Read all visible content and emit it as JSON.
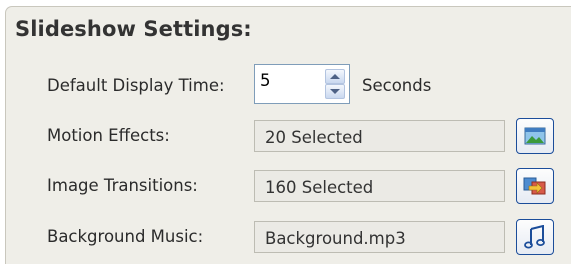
{
  "section_title": "Slideshow Settings:",
  "display_time": {
    "label": "Default Display Time:",
    "value": "5",
    "unit": "Seconds"
  },
  "motion_effects": {
    "label": "Motion Effects:",
    "value": "20 Selected",
    "button_icon": "image-icon"
  },
  "image_transitions": {
    "label": "Image Transitions:",
    "value": "160 Selected",
    "button_icon": "transition-icon"
  },
  "background_music": {
    "label": "Background Music:",
    "value": "Background.mp3",
    "button_icon": "music-note-icon"
  },
  "colors": {
    "panel_background": "#efeee8",
    "button_border": "#1b4d9a",
    "input_border": "#7f9db9"
  }
}
